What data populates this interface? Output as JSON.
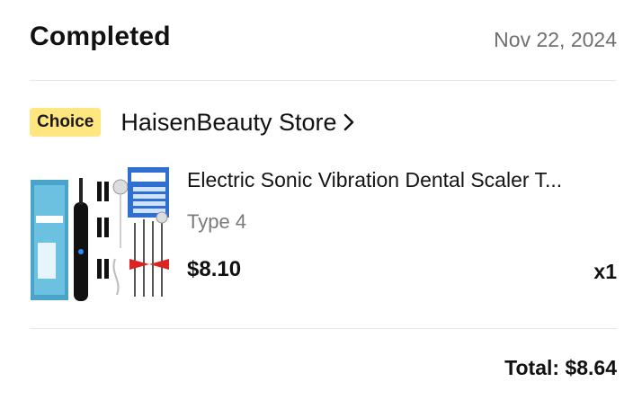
{
  "order": {
    "status": "Completed",
    "date": "Nov 22, 2024",
    "total_label": "Total: $8.64"
  },
  "store": {
    "badge": "Choice",
    "name": "HaisenBeauty Store",
    "chevron_icon": "chevron-right-icon"
  },
  "item": {
    "title": "Electric Sonic Vibration Dental Scaler T...",
    "variant": "Type 4",
    "price": "$8.10",
    "quantity": "x1",
    "image_icon": "product-thumbnail"
  },
  "colors": {
    "badge_bg": "#ffe680",
    "muted_text": "#7a7a7a",
    "divider": "#e7e7e7"
  }
}
